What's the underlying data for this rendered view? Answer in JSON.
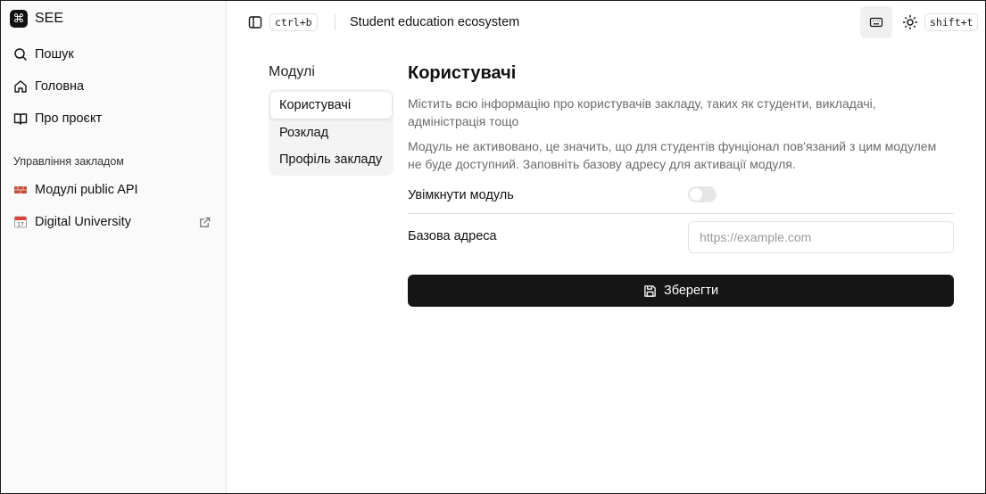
{
  "app": {
    "name": "SEE"
  },
  "sidebar": {
    "items": [
      {
        "label": "Пошук",
        "icon": "search-icon"
      },
      {
        "label": "Головна",
        "icon": "home-icon"
      },
      {
        "label": "Про проєкт",
        "icon": "book-icon"
      }
    ],
    "section_label": "Управління закладом",
    "management_items": [
      {
        "label": "Модулі public API",
        "icon": "brick-icon",
        "emoji": "🧱"
      },
      {
        "label": "Digital University",
        "icon": "calendar-icon",
        "emoji": "📅",
        "external": true
      }
    ]
  },
  "header": {
    "sidebar_shortcut": "ctrl+b",
    "title": "Student education ecosystem",
    "theme_shortcut": "shift+t"
  },
  "modules": {
    "heading": "Модулі",
    "tabs": [
      {
        "label": "Користувачі",
        "active": true
      },
      {
        "label": "Розклад",
        "active": false
      },
      {
        "label": "Профіль закладу",
        "active": false
      }
    ]
  },
  "content": {
    "title": "Користувачі",
    "description": "Містить всю інформацію про користувачів закладу, таких як студенти, викладачі, адміністрація тощо",
    "status_note": "Модуль не активовано, це значить, що для студентів фунціонал пов'язаний з цим модулем не буде доступний. Заповніть базову адресу для активації модуля.",
    "enable_label": "Увімкнути модуль",
    "enabled": false,
    "base_url_label": "Базова адреса",
    "base_url_value": "",
    "base_url_placeholder": "https://example.com",
    "save_label": "Зберегти"
  }
}
